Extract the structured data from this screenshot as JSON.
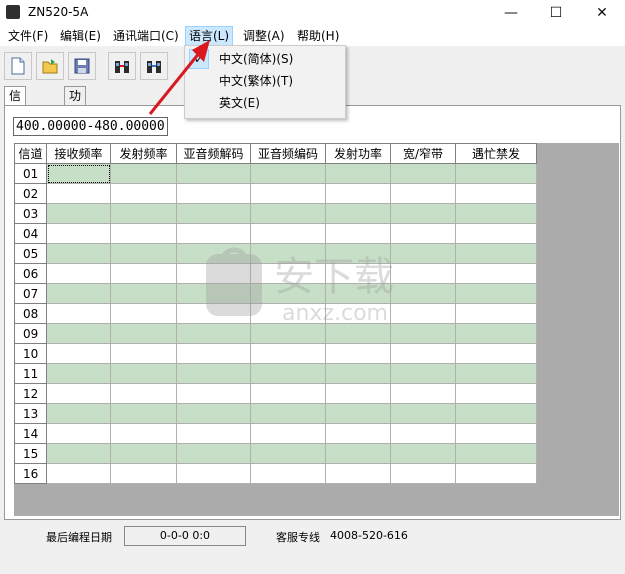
{
  "window": {
    "title": "ZN520-5A",
    "minimize_glyph": "—",
    "maximize_glyph": "☐",
    "close_glyph": "✕"
  },
  "menu": [
    {
      "label": "文件(F)"
    },
    {
      "label": "编辑(E)"
    },
    {
      "label": "通讯端口(C)"
    },
    {
      "label": "语言(L)"
    },
    {
      "label": "调整(A)"
    },
    {
      "label": "帮助(H)"
    }
  ],
  "language_menu": {
    "items": [
      {
        "label": "中文(简体)(S)",
        "checked": true
      },
      {
        "label": "中文(繁体)(T)",
        "checked": false
      },
      {
        "label": "英文(E)",
        "checked": false
      }
    ],
    "check_glyph": "✓"
  },
  "toolbar": [
    {
      "icon": "new-file-icon"
    },
    {
      "icon": "open-folder-icon"
    },
    {
      "icon": "save-disk-icon"
    },
    {
      "icon": "read-radio-icon"
    },
    {
      "icon": "write-radio-icon"
    }
  ],
  "tabs": [
    {
      "label": "信道编辑",
      "selected": true
    },
    {
      "label": "功能选项",
      "selected": false
    }
  ],
  "frequency_range": "400.00000-480.00000",
  "grid": {
    "columns": [
      "信道",
      "接收频率",
      "发射频率",
      "亚音频解码",
      "亚音频编码",
      "发射功率",
      "宽/窄带",
      "遇忙禁发"
    ],
    "rows": [
      "01",
      "02",
      "03",
      "04",
      "05",
      "06",
      "07",
      "08",
      "09",
      "10",
      "11",
      "12",
      "13",
      "14",
      "15",
      "16"
    ]
  },
  "status": {
    "last_program_label": "最后编程日期",
    "last_program_value": "0-0-0   0:0",
    "service_label": "客服专线",
    "service_phone": "4008-520-616"
  },
  "watermark": {
    "text_cn": "安下载",
    "text_en": "anxz.com"
  },
  "colors": {
    "row_alt": "#c7dfc7",
    "menu_highlight": "#cce8ff",
    "arrow": "#d9191f"
  }
}
